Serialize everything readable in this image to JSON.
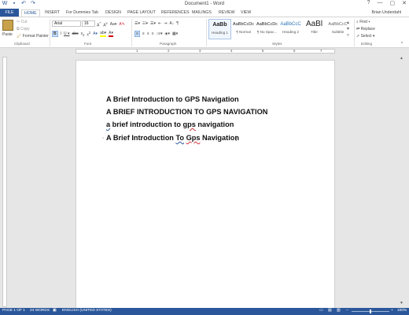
{
  "window": {
    "title": "Document1 - Word",
    "controls": [
      "?",
      "—",
      "▢",
      "✕"
    ]
  },
  "tabs": [
    "FILE",
    "HOME",
    "INSERT",
    "For Dummies Tab",
    "DESIGN",
    "PAGE LAYOUT",
    "REFERENCES",
    "MAILINGS",
    "REVIEW",
    "VIEW"
  ],
  "active_tab": "HOME",
  "user": "Brian Underdahl",
  "ribbon": {
    "clipboard": {
      "paste": "Paste",
      "cut": "Cut",
      "copy": "Copy",
      "format_painter": "Format Painter",
      "label": "Clipboard"
    },
    "font": {
      "name": "Arial",
      "size": "16",
      "label": "Font"
    },
    "paragraph": {
      "label": "Paragraph"
    },
    "styles": {
      "label": "Styles",
      "items": [
        {
          "preview": "AaBb",
          "name": "Heading 1"
        },
        {
          "preview": "AaBbCcDc",
          "name": "¶ Normal"
        },
        {
          "preview": "AaBbCcDc",
          "name": "¶ No Spac..."
        },
        {
          "preview": "AaBbCcC",
          "name": "Heading 2"
        },
        {
          "preview": "AaBl",
          "name": "Title"
        },
        {
          "preview": "AaBbCcC",
          "name": "Subtitle"
        }
      ]
    },
    "editing": {
      "find": "Find",
      "replace": "Replace",
      "select": "Select",
      "label": "Editing"
    }
  },
  "ruler": {
    "numbers": [
      "1",
      "2",
      "3",
      "4",
      "5",
      "6",
      "7"
    ]
  },
  "document": {
    "lines": [
      "A Brief Introduction to GPS Navigation",
      "A BRIEF INTRODUCTION TO GPS NAVIGATION",
      "a brief introduction to gps navigation",
      "A Brief Introduction To Gps Navigation"
    ],
    "line3_prefix": "a",
    "line3_mid": " brief introduction to ",
    "line3_squig": "gps",
    "line3_suffix": " navigation",
    "line4_prefix": "A Brief Introduction ",
    "line4_to": "To",
    "line4_space": " ",
    "line4_gps": "Gps",
    "line4_suffix": " Navigation"
  },
  "status": {
    "page": "PAGE 1 OF 1",
    "words": "24 WORDS",
    "language": "ENGLISH (UNITED STATES)",
    "zoom": "100%"
  },
  "colors": {
    "accent": "#2b579a",
    "spell_error": "#d13438"
  }
}
